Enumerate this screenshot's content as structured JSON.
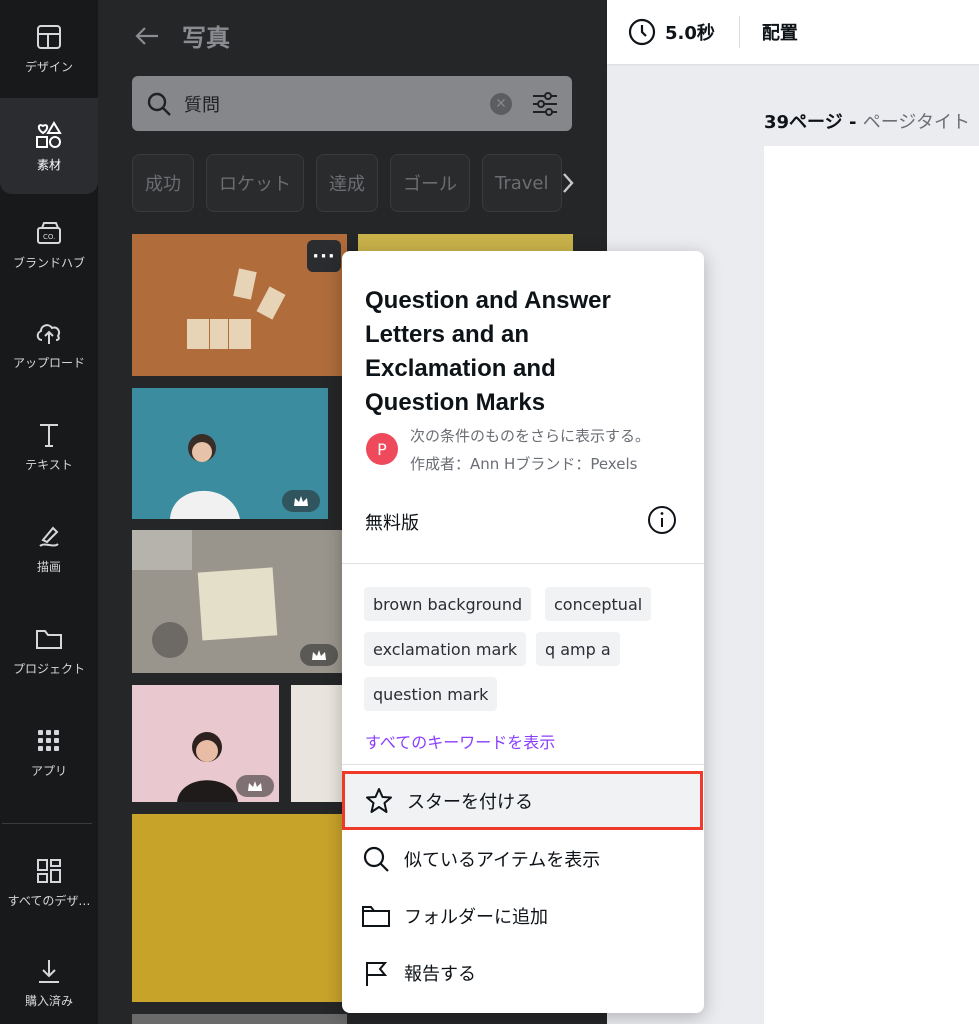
{
  "sidebar": {
    "items": [
      {
        "label": "デザイン",
        "icon": "layout-icon"
      },
      {
        "label": "素材",
        "icon": "elements-icon"
      },
      {
        "label": "ブランドハブ",
        "icon": "brand-icon"
      },
      {
        "label": "アップロード",
        "icon": "upload-icon"
      },
      {
        "label": "テキスト",
        "icon": "text-icon"
      },
      {
        "label": "描画",
        "icon": "draw-icon"
      },
      {
        "label": "プロジェクト",
        "icon": "folder-icon"
      },
      {
        "label": "アプリ",
        "icon": "apps-icon"
      },
      {
        "label": "すべてのデザ…",
        "icon": "all-designs-icon"
      },
      {
        "label": "購入済み",
        "icon": "download-icon"
      }
    ]
  },
  "panel": {
    "title": "写真",
    "search": {
      "value": "質問"
    },
    "chips": [
      "成功",
      "ロケット",
      "達成",
      "ゴール",
      "Travel"
    ]
  },
  "topbar": {
    "duration": "5.0秒",
    "position": "配置"
  },
  "page_label": {
    "number": "39ページ - ",
    "title": "ページタイト"
  },
  "popup": {
    "title": "Question and Answer Letters and an Exclamation and Question Marks",
    "avatar": "P",
    "subtitle": "次の条件のものをさらに表示する。",
    "author": "作成者：Ann Hブランド：Pexels",
    "license": "無料版",
    "tags": [
      "brown background",
      "conceptual",
      "exclamation mark",
      "q amp a",
      "question mark"
    ],
    "show_all_keywords": "すべてのキーワードを表示",
    "menu": [
      {
        "label": "スターを付ける",
        "icon": "star-icon"
      },
      {
        "label": "似ているアイテムを表示",
        "icon": "search-icon"
      },
      {
        "label": "フォルダーに追加",
        "icon": "folder-icon"
      },
      {
        "label": "報告する",
        "icon": "flag-icon"
      }
    ]
  },
  "colors": {
    "accent": "#8b3dff",
    "highlight": "#ef3a2a",
    "avatar": "#ef4a5c"
  }
}
